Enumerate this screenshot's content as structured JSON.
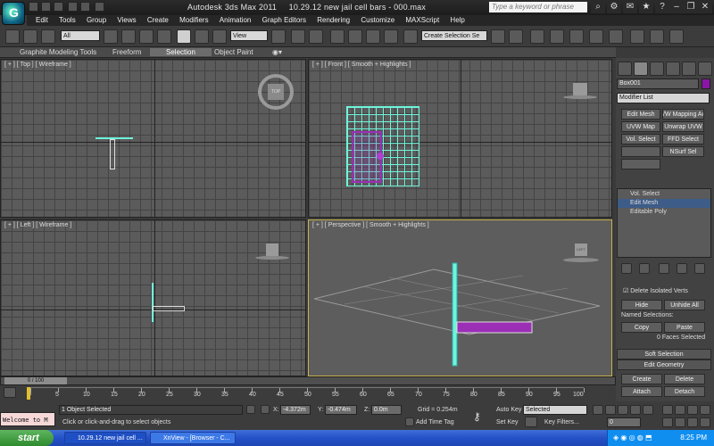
{
  "titlebar": {
    "app_name": "Autodesk 3ds Max  2011",
    "file_name": "10.29.12 new jail cell bars - 000.max",
    "search_placeholder": "Type a keyword or phrase"
  },
  "menus": [
    "Edit",
    "Tools",
    "Group",
    "Views",
    "Create",
    "Modifiers",
    "Animation",
    "Graph Editors",
    "Rendering",
    "Customize",
    "MAXScript",
    "Help"
  ],
  "toolbar": {
    "selection_filter": "All",
    "reference_coord": "View",
    "named_selection": "Create Selection Se"
  },
  "ribbon": {
    "tabs": [
      "Graphite Modeling Tools",
      "Freeform",
      "Selection",
      "Object Paint"
    ]
  },
  "viewports": {
    "top": "[ + ] [ Top ] [ Wireframe ]",
    "front": "[ + ] [ Front ] [ Smooth + Highlights ]",
    "left": "[ + ] [ Left ] [ Wireframe ]",
    "perspective": "[ + ] [ Perspective ] [ Smooth + Highlights ]",
    "viewcube_top": "TOP",
    "viewcube_left": "LEFT"
  },
  "command_panel": {
    "object_name": "Box001",
    "modifier_list": "Modifier List",
    "buttons": [
      "Edit Mesh",
      "UVW Map",
      "Vol. Select",
      "/W Mapping Ac",
      "Unwrap UVW",
      "FFD Select",
      "NSurf Sel"
    ],
    "stack": [
      "Vol. Select",
      "Edit Mesh",
      "Editable Poly"
    ],
    "delete_isolated": "Delete Isolated Verts",
    "hide": "Hide",
    "unhide_all": "Unhide All",
    "named_selections": "Named Selections:",
    "copy": "Copy",
    "paste": "Paste",
    "faces_selected": "0 Faces Selected",
    "soft_selection": "Soft Selection",
    "edit_geometry": "Edit Geometry",
    "create": "Create",
    "delete": "Delete",
    "attach": "Attach",
    "detach": "Detach"
  },
  "timeline": {
    "frame_label": "0 / 100",
    "ticks": [
      "0",
      "5",
      "10",
      "15",
      "20",
      "25",
      "30",
      "35",
      "40",
      "45",
      "50",
      "55",
      "60",
      "65",
      "70",
      "75",
      "80",
      "85",
      "90",
      "95",
      "100"
    ]
  },
  "status": {
    "listener": "Welcome to M",
    "selected": "1 Object Selected",
    "prompt": "Click or click-and-drag to select objects",
    "x_label": "X:",
    "x": "-4.372m",
    "y_label": "Y:",
    "y": "-0.474m",
    "z_label": "Z:",
    "z": "0.0m",
    "grid": "Grid = 0.254m",
    "add_time_tag": "Add Time Tag",
    "auto_key": "Auto Key",
    "key_mode": "Selected",
    "set_key": "Set Key",
    "key_filters": "Key Filters...",
    "frame": "0"
  },
  "taskbar": {
    "start": "start",
    "tasks": [
      "10.29.12 new jail cell ...",
      "XnView - [Browser - C..."
    ],
    "clock": "8:25 PM"
  }
}
